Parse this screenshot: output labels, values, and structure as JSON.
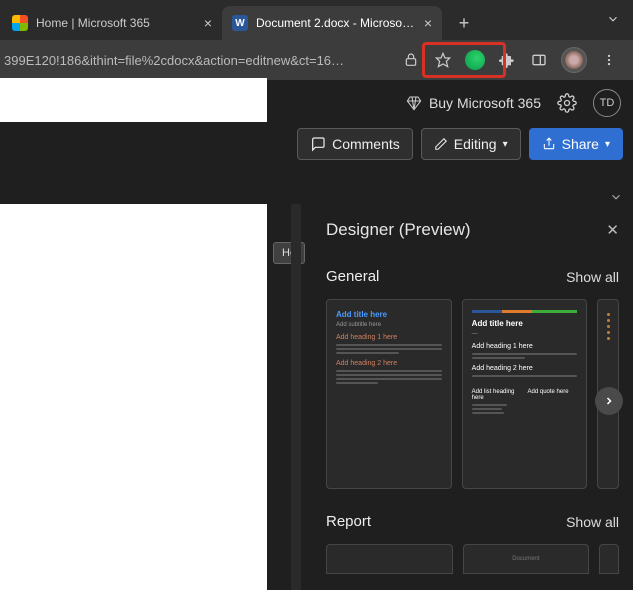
{
  "tabs": {
    "home": {
      "label": "Home | Microsoft 365"
    },
    "doc": {
      "label": "Document 2.docx - Microsoft W"
    }
  },
  "plus": "+",
  "url": "399E120!186&ithint=file%2cdocx&action=editnew&ct=16…",
  "header": {
    "buy": "Buy Microsoft 365",
    "initials": "TD"
  },
  "ribbon": {
    "comments": "Comments",
    "editing": "Editing",
    "share": "Share"
  },
  "tooltip": "He",
  "designer": {
    "title": "Designer (Preview)",
    "sections": {
      "general": {
        "title": "General",
        "showall": "Show all"
      },
      "report": {
        "title": "Report",
        "showall": "Show all"
      }
    },
    "card1": {
      "title": "Add title here",
      "subtitle": "Add subtitle here",
      "h1": "Add heading 1 here",
      "h2": "Add heading 2 here"
    },
    "card2": {
      "title": "Add title here",
      "h1": "Add heading 1 here",
      "h2": "Add heading 2 here",
      "lh": "Add list heading here",
      "quote": "Add quote here"
    },
    "rcard2_text": "Document"
  }
}
